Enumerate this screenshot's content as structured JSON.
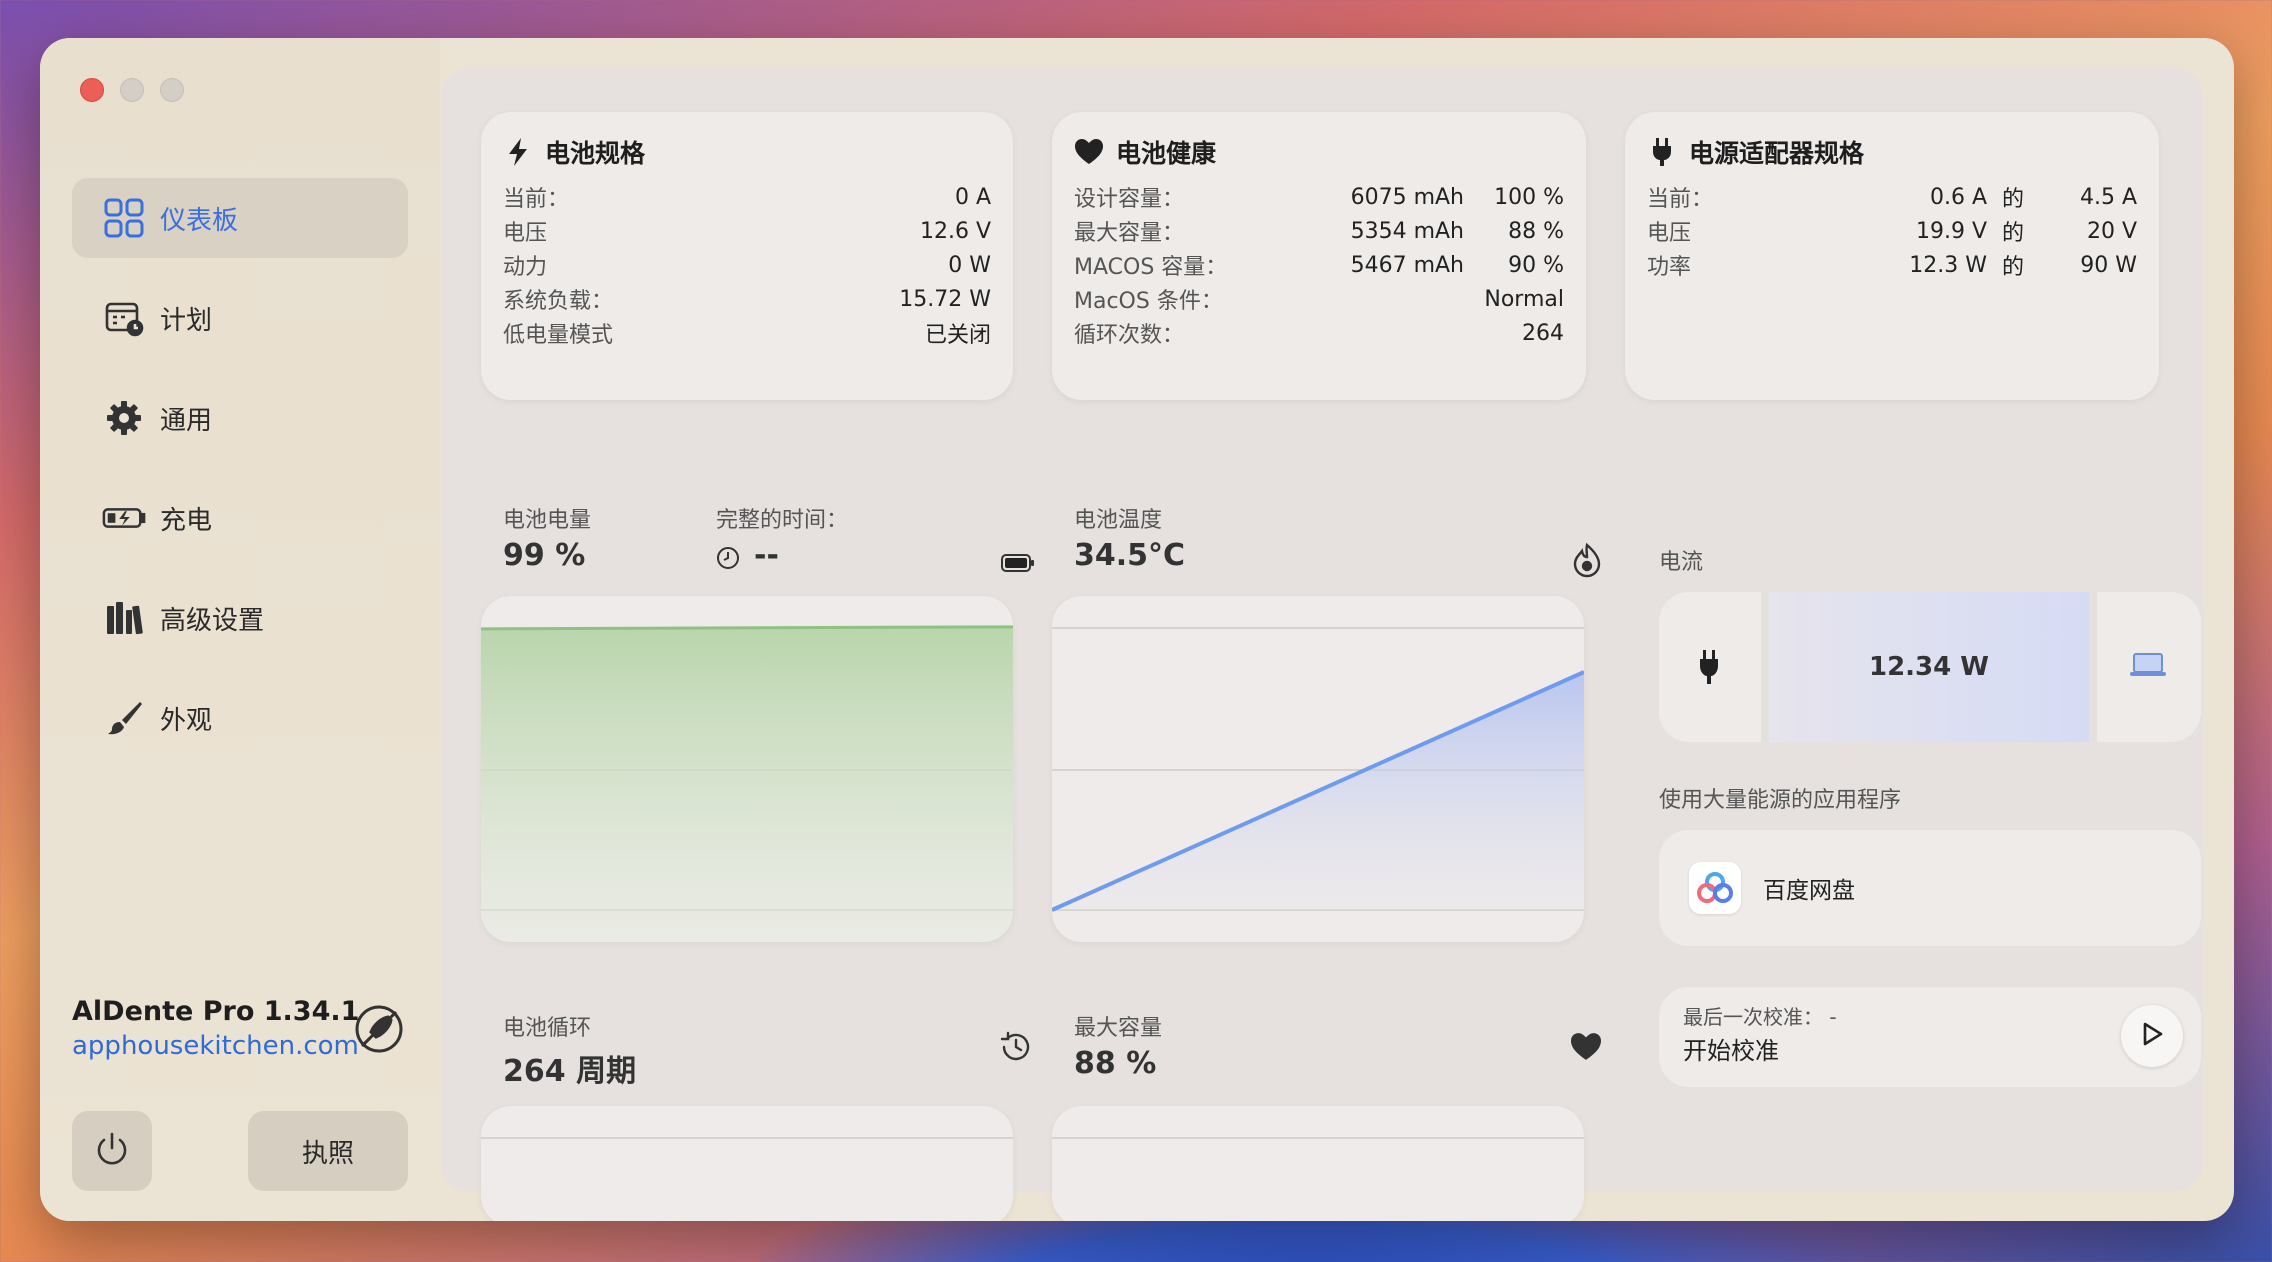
{
  "sidebar": {
    "items": [
      {
        "label": "仪表板",
        "icon": "dashboard-icon",
        "active": true
      },
      {
        "label": "计划",
        "icon": "calendar-clock-icon",
        "active": false
      },
      {
        "label": "通用",
        "icon": "gear-icon",
        "active": false
      },
      {
        "label": "充电",
        "icon": "battery-charging-icon",
        "active": false
      },
      {
        "label": "高级设置",
        "icon": "books-icon",
        "active": false
      },
      {
        "label": "外观",
        "icon": "paintbrush-icon",
        "active": false
      }
    ],
    "brand_title": "AlDente Pro 1.34.1",
    "brand_link": "apphousekitchen.com",
    "license_label": "执照"
  },
  "battery_spec": {
    "title": "电池规格",
    "rows": [
      {
        "label": "当前：",
        "value": "0 A"
      },
      {
        "label": "电压",
        "value": "12.6 V"
      },
      {
        "label": "动力",
        "value": "0 W"
      },
      {
        "label": "系统负载：",
        "value": "15.72 W"
      },
      {
        "label": "低电量模式",
        "value": "已关闭"
      }
    ]
  },
  "battery_health": {
    "title": "电池健康",
    "rows": [
      {
        "label": "设计容量：",
        "value": "6075 mAh",
        "pct": "100 %"
      },
      {
        "label": "最大容量：",
        "value": "5354 mAh",
        "pct": "88 %"
      },
      {
        "label": "MACOS 容量：",
        "value": "5467 mAh",
        "pct": "90 %"
      },
      {
        "label": "MacOS 条件：",
        "value": "Normal",
        "pct": ""
      },
      {
        "label": "循环次数：",
        "value": "264",
        "pct": ""
      }
    ]
  },
  "adapter_spec": {
    "title": "电源适配器规格",
    "rows": [
      {
        "label": "当前：",
        "value": "0.6 A",
        "of": "的",
        "max": "4.5 A"
      },
      {
        "label": "电压",
        "value": "19.9 V",
        "of": "的",
        "max": "20 V"
      },
      {
        "label": "功率",
        "value": "12.3 W",
        "of": "的",
        "max": "90 W"
      }
    ]
  },
  "battery_level": {
    "label": "电池电量",
    "value": "99 %",
    "time_label": "完整的时间：",
    "time_value": "--",
    "level_fraction": 0.99
  },
  "battery_temp": {
    "label": "电池温度",
    "value": "34.5°C"
  },
  "current_flow": {
    "label": "电流",
    "value": "12.34 W"
  },
  "apps": {
    "label": "使用大量能源的应用程序",
    "items": [
      {
        "name": "百度网盘"
      }
    ]
  },
  "calibration": {
    "sub": "最后一次校准：  -",
    "title": "开始校准"
  },
  "battery_cycle": {
    "label": "电池循环",
    "value": "264 周期"
  },
  "max_capacity": {
    "label": "最大容量",
    "value": "88 %"
  },
  "colors": {
    "accent": "#3a6fe0",
    "level_green": "#a9cf9a",
    "temp_blue": "#6f9bef"
  }
}
